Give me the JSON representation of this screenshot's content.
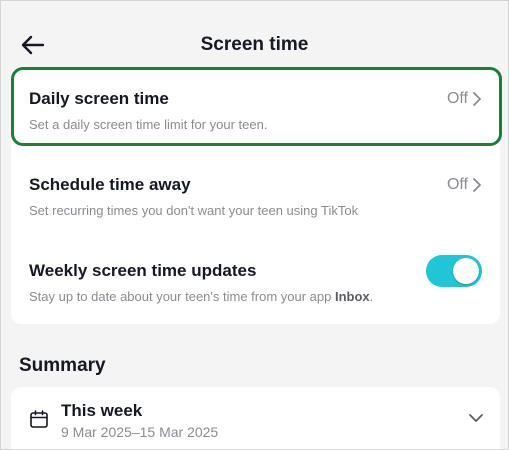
{
  "header": {
    "title": "Screen time",
    "back_icon": "arrow-left-icon"
  },
  "settings": [
    {
      "title": "Daily screen time",
      "description": "Set a daily screen time limit for your teen.",
      "value": "Off",
      "highlighted": true,
      "highlight_color": "#1a7f3a"
    },
    {
      "title": "Schedule time away",
      "description": "Set recurring times you don't want your teen using TikTok",
      "value": "Off"
    },
    {
      "title": "Weekly screen time updates",
      "description_prefix": "Stay up to date about your teen's time from your app ",
      "description_bold": "Inbox",
      "description_suffix": ".",
      "toggle_on": true,
      "toggle_color": "#1fc6d6"
    }
  ],
  "summary": {
    "label": "Summary",
    "period_title": "This week",
    "period_range": "9 Mar 2025–15 Mar 2025",
    "calendar_icon": "calendar-icon",
    "expand_icon": "chevron-down-icon"
  }
}
